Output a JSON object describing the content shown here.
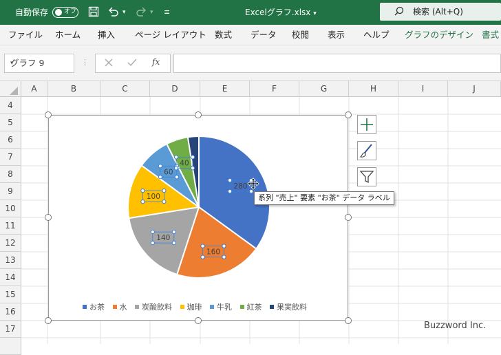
{
  "titlebar": {
    "autosave_label": "自動保存",
    "autosave_state": "オフ",
    "file_name": "Excelグラフ.xlsx",
    "search_placeholder": "検索 (Alt+Q)",
    "accent": "#217346"
  },
  "ribbon": {
    "tabs": [
      "ファイル",
      "ホーム",
      "挿入",
      "ページ レイアウト",
      "数式",
      "データ",
      "校閲",
      "表示",
      "ヘルプ",
      "グラフのデザイン",
      "書式"
    ]
  },
  "formula_bar": {
    "name_box": "グラフ 9",
    "formula_value": ""
  },
  "columns": [
    "A",
    "B",
    "C",
    "D",
    "E",
    "F",
    "G",
    "H",
    "I",
    "J"
  ],
  "rows": [
    "4",
    "5",
    "6",
    "7",
    "8",
    "9",
    "10",
    "11",
    "12",
    "13",
    "14",
    "15",
    "16",
    "17"
  ],
  "chart_data": {
    "type": "pie",
    "categories": [
      "お茶",
      "水",
      "炭酸飲料",
      "珈琲",
      "牛乳",
      "紅茶",
      "果実飲料"
    ],
    "values": [
      280,
      160,
      140,
      100,
      60,
      40,
      20
    ],
    "colors": [
      "#4472c4",
      "#ed7d31",
      "#a5a5a5",
      "#ffc000",
      "#5b9bd5",
      "#70ad47",
      "#264478"
    ],
    "data_labels": [
      "280",
      "160",
      "140",
      "100",
      "60",
      "40",
      ""
    ],
    "legend_position": "bottom"
  },
  "tooltip": "系列 \"売上\" 要素 \"お茶\" データ ラベル",
  "watermark": "Buzzword Inc."
}
